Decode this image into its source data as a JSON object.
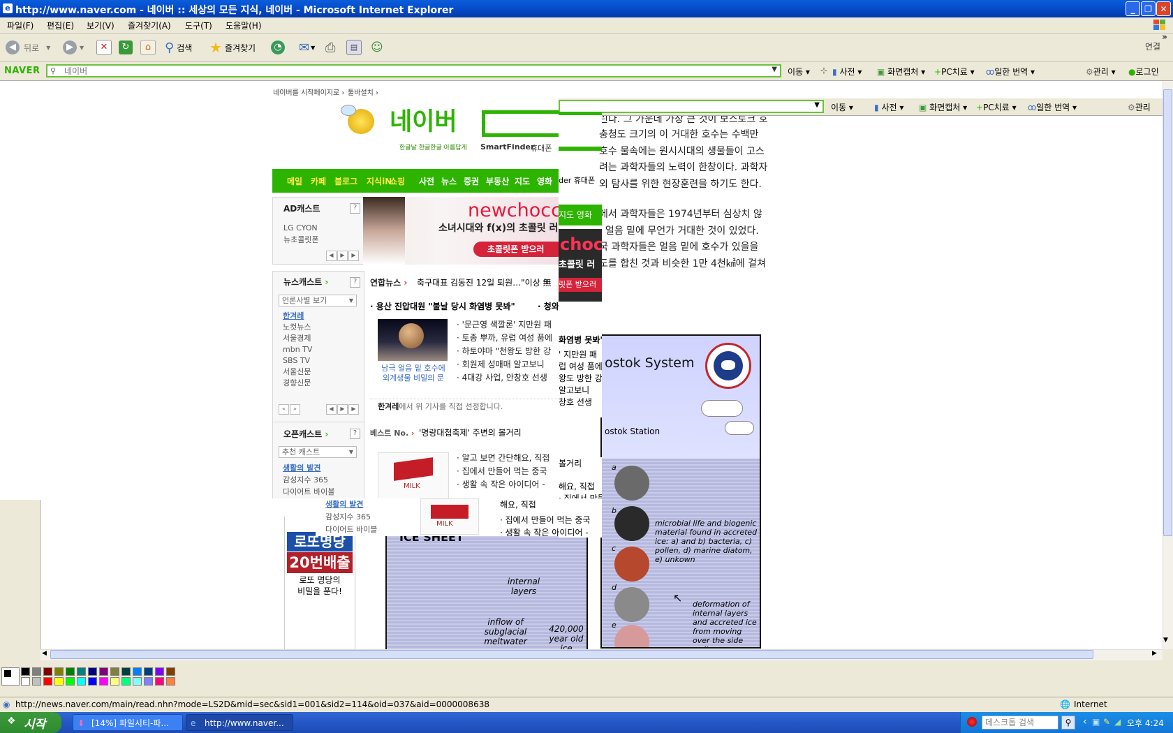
{
  "window": {
    "title": "http://www.naver.com - 네이버 :: 세상의 모든 지식, 네이버 - Microsoft Internet Explorer",
    "minimize": "_",
    "restore": "❐",
    "close": "✕"
  },
  "menu": [
    "파일(F)",
    "편집(E)",
    "보기(V)",
    "즐겨찾기(A)",
    "도구(T)",
    "도움말(H)"
  ],
  "toolbar": {
    "back": "뒤로",
    "search": "검색",
    "favorites": "즐겨찾기",
    "links": "연결",
    "more": "»"
  },
  "naver_toolbar": {
    "logo": "NAVER",
    "search_placeholder": "네이버",
    "items": [
      "이동",
      "사전",
      "화면캡처",
      "PC치료",
      "일한 번역",
      "관리",
      "로그인"
    ]
  },
  "naver_toolbar_dup": {
    "items": [
      "이동",
      "사전",
      "화면캡처",
      "PC치료",
      "일한 번역",
      "관리"
    ]
  },
  "naver_page": {
    "top_links": [
      "네이버를 시작페이지로",
      "툴바설치"
    ],
    "logo": "네이버",
    "logo_sub": "한글날 한글한글 아름답게",
    "smartfinder": "SmartFinder",
    "phone": "휴대폰",
    "phone_dup": "der 휴대폰",
    "nav": [
      "메일",
      "카페",
      "블로그",
      "지식iN",
      "쇼핑",
      "사전",
      "뉴스",
      "증권",
      "부동산",
      "지도",
      "영화"
    ],
    "nav_dup": [
      "지도",
      "영화"
    ],
    "adcast": {
      "title": "AD캐스트",
      "items": [
        "LG CYON",
        "뉴초콜릿폰"
      ]
    },
    "banner": {
      "brand": "newchocc",
      "line": "소녀시대와 f(x)의 초콜릿 러",
      "button": "초콜릿폰 받으러"
    },
    "banner_dup": {
      "brand": "chocc",
      "line": "초콜릿 러",
      "button": "릿폰 받으러"
    },
    "newscast": {
      "title": "뉴스캐스트",
      "select": "언론사별 보기",
      "sources": [
        "한겨레",
        "노컷뉴스",
        "서울경제",
        "mbn TV",
        "SBS TV",
        "서울신문",
        "경향신문"
      ],
      "tab": "연합뉴스",
      "ticker": "축구대표 김동진 12일 퇴원…\"이상 無",
      "headline": "· 용산 진압대원 \"불날 당시 화염병 못봐\"",
      "headline_tail": "· 청와",
      "img_caption": [
        "남극 얼음 밑 호수에",
        "외계생물 비밀의 문"
      ],
      "items": [
        "· '문근영 색깔론' 지만원 패",
        "· 토종 뿌까, 유럽 여성 품에",
        "· 하토야마 \"천왕도 방한 강",
        "· 회원제 성매매 알고보니",
        "· 4대강 사업, 안창호 선생"
      ],
      "footer_src": "한겨레",
      "footer": "에서 위 기사를 직접 선정합니다."
    },
    "newscast_dup": {
      "headline": "화염병 못봐\" · 청와",
      "items": [
        "' 지만원 패",
        "럽 여성 품에",
        "왕도 방한 강",
        "알고보니",
        "창호 선생"
      ]
    },
    "opencast": {
      "title": "오픈캐스트",
      "select": "추천 캐스트",
      "cats": [
        "생활의 발견",
        "감성지수 365",
        "다이어트 바이블"
      ],
      "best": "베스트 No.",
      "best_title": "'명랑대첩축제' 주변의 볼거리",
      "items": [
        "· 알고 보면 간단해요, 직접",
        "· 집에서 만들어 먹는 중국",
        "· 생활 속 작은 아이디어 -"
      ],
      "milk": "MILK",
      "tail": "볼거리"
    },
    "opencast_dup": {
      "cats": [
        "생활의 발견",
        "감성지수 365",
        "다이어트 바이블"
      ],
      "items": [
        "해요, 직접",
        "· 집에서 만들어 먹는 중국",
        "· 생활 속 작은 아이디어 -"
      ],
      "milk": "MILK"
    }
  },
  "article": {
    "lines": [
      "린다. 그 가운데 가장 큰 것이 보스토크 호",
      "충청도 크기의 이 거대한 호수는 수백만",
      "호수 물속에는 원시시대의 생물들이 고스",
      "려는 과학자들의 노력이 한창이다. 과학자",
      "외 탐사를 위한 현장훈련을 하기도 한다.",
      "에서 과학자들은 1974년부터 심상치 않",
      ". 얼음 밑에 무언가 거대한 것이 있었다.",
      "국 과학자들은 얼음 밑에 호수가 있을을",
      "도를 합친 것과 비슷한 1만 4천㎢에 걸쳐"
    ]
  },
  "lotto": {
    "title1": "로또명당",
    "title2": "20번배출",
    "caption": [
      "로또 명당의",
      "비밀을 푼다!"
    ]
  },
  "diagram": {
    "title": "ostok System",
    "station": "ostok Station",
    "ice_sheet": "ICE SHEET",
    "labels": [
      "internal layers",
      "inflow of subglacial meltwater",
      "420,000 year old ice"
    ],
    "circles": [
      "a",
      "b",
      "c",
      "d",
      "e"
    ],
    "microbial": "microbial life and biogenic material found in accreted ice: a) and b) bacteria, c) pollen, d) marine diatom, e) unkown",
    "deformation": "deformation of internal layers and accreted ice from moving over the side walls"
  },
  "status": {
    "url": "http://news.naver.com/main/read.nhn?mode=LS2D&mid=sec&sid1=001&sid2=114&oid=037&aid=0000008638",
    "zone": "Internet"
  },
  "taskbar": {
    "start": "시작",
    "tasks": [
      "[14%] 파일시티-파...",
      "http://www.naver..."
    ],
    "search_placeholder": "데스크톱 검색",
    "clock": "오후 4:24"
  },
  "colors": {
    "naver_green": "#2db400",
    "xp_blue": "#0548c4",
    "start_green": "#3c9a3c"
  }
}
